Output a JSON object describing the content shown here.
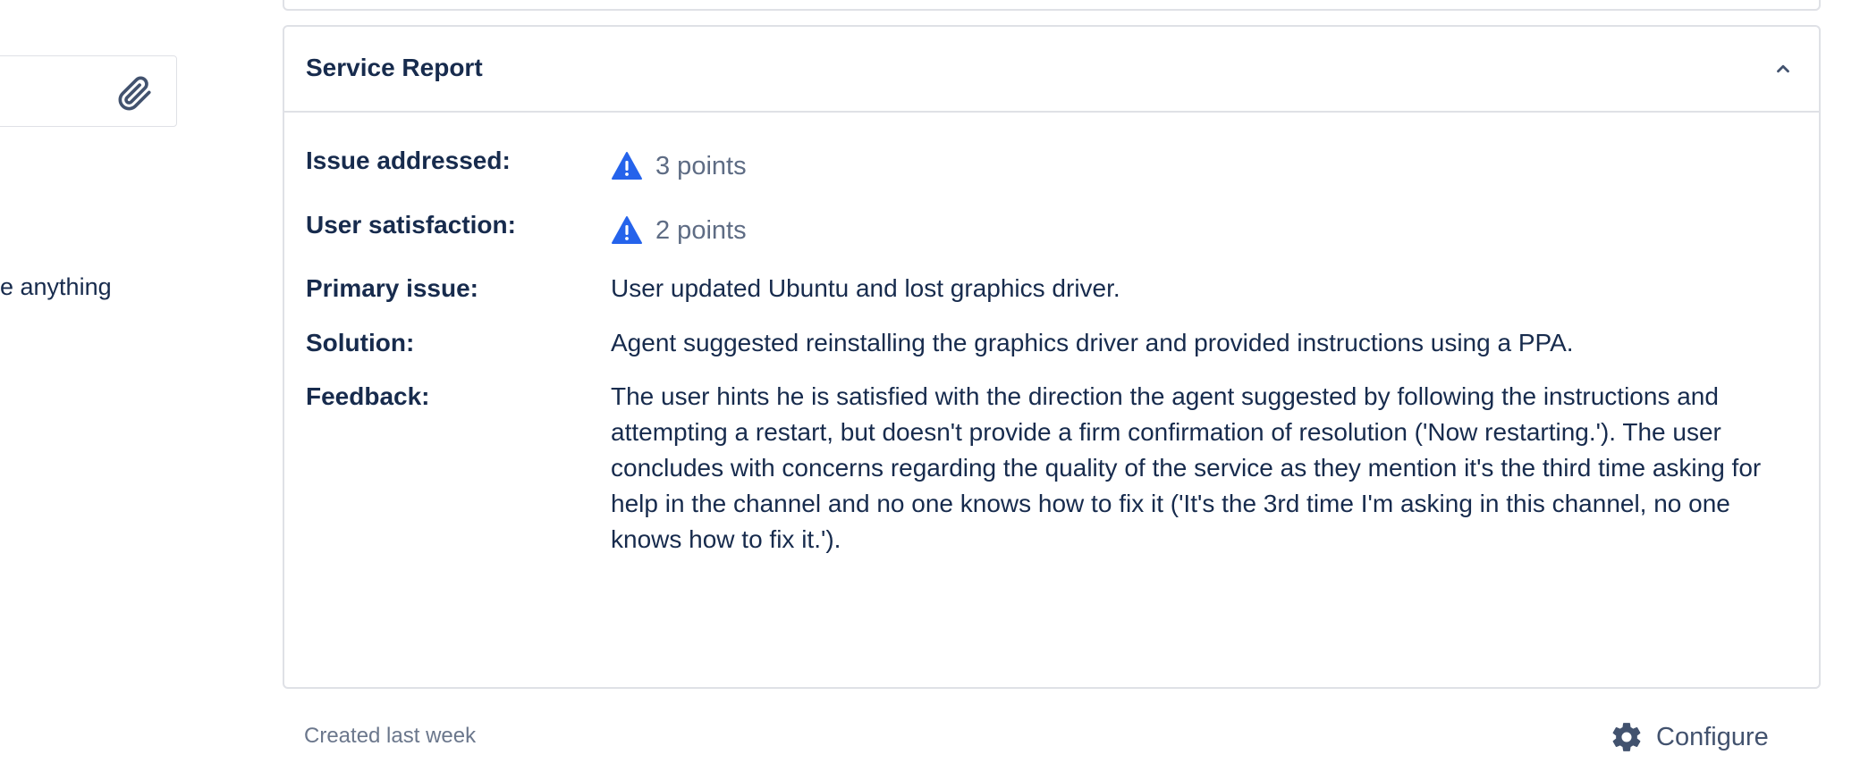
{
  "left_panel": {
    "top_fragment": "",
    "partial_text": "e anything",
    "attach_icon": "paperclip-icon"
  },
  "service_report": {
    "title": "Service Report",
    "collapse_icon": "chevron-up-icon",
    "rows": [
      {
        "label": "Issue addressed:",
        "points": "3 points",
        "icon": "warning-icon"
      },
      {
        "label": "User satisfaction:",
        "points": "2 points",
        "icon": "warning-icon"
      },
      {
        "label": "Primary issue:",
        "value": "User updated Ubuntu and lost graphics driver."
      },
      {
        "label": "Solution:",
        "value": "Agent suggested reinstalling the graphics driver and provided instructions using a PPA."
      },
      {
        "label": "Feedback:",
        "value": "The user hints he is satisfied with the direction the agent suggested by following the instructions and attempting a restart, but doesn't provide a firm confirmation of resolution ('Now restarting.'). The user concludes with concerns regarding the quality of the service as they mention it's the third time asking for help in the channel and no one knows how to fix it ('It's the 3rd time I'm asking in this channel, no one knows how to fix it.')."
      }
    ]
  },
  "footer": {
    "created": "Created last week",
    "configure_label": "Configure",
    "configure_icon": "gear-icon"
  },
  "colors": {
    "warning": "#2563eb",
    "text": "#172b4d",
    "muted": "#6b778c",
    "border": "#dfe1e6"
  }
}
